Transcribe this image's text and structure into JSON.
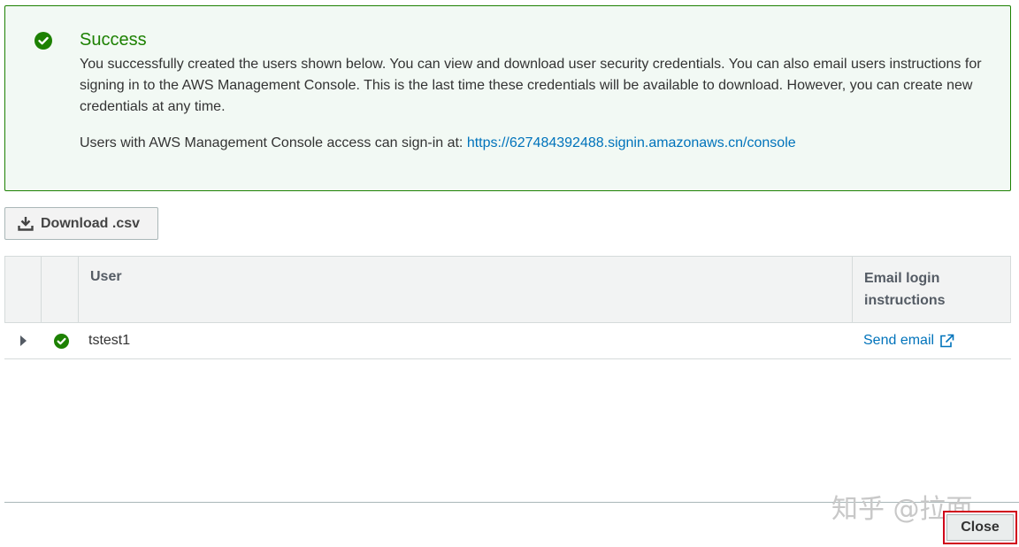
{
  "alert": {
    "title": "Success",
    "body": "You successfully created the users shown below. You can view and download user security credentials. You can also email users instructions for signing in to the AWS Management Console. This is the last time these credentials will be available to download. However, you can create new credentials at any time.",
    "console_prefix": "Users with AWS Management Console access can sign-in at: ",
    "console_link": "https://627484392488.signin.amazonaws.cn/console",
    "icon": "check-circle-icon"
  },
  "toolbar": {
    "download_label": "Download .csv",
    "download_icon": "download-icon"
  },
  "table": {
    "columns": [
      "User",
      "Email login instructions"
    ],
    "rows": [
      {
        "user": "tstest1",
        "status_icon": "check-circle-icon",
        "action_label": "Send email",
        "action_icon": "external-link-icon"
      }
    ]
  },
  "footer": {
    "close_label": "Close",
    "watermark": "知乎 @拉面"
  },
  "colors": {
    "success_green": "#1d8102",
    "link_blue": "#0073bb",
    "highlight_red": "#d0021b"
  }
}
